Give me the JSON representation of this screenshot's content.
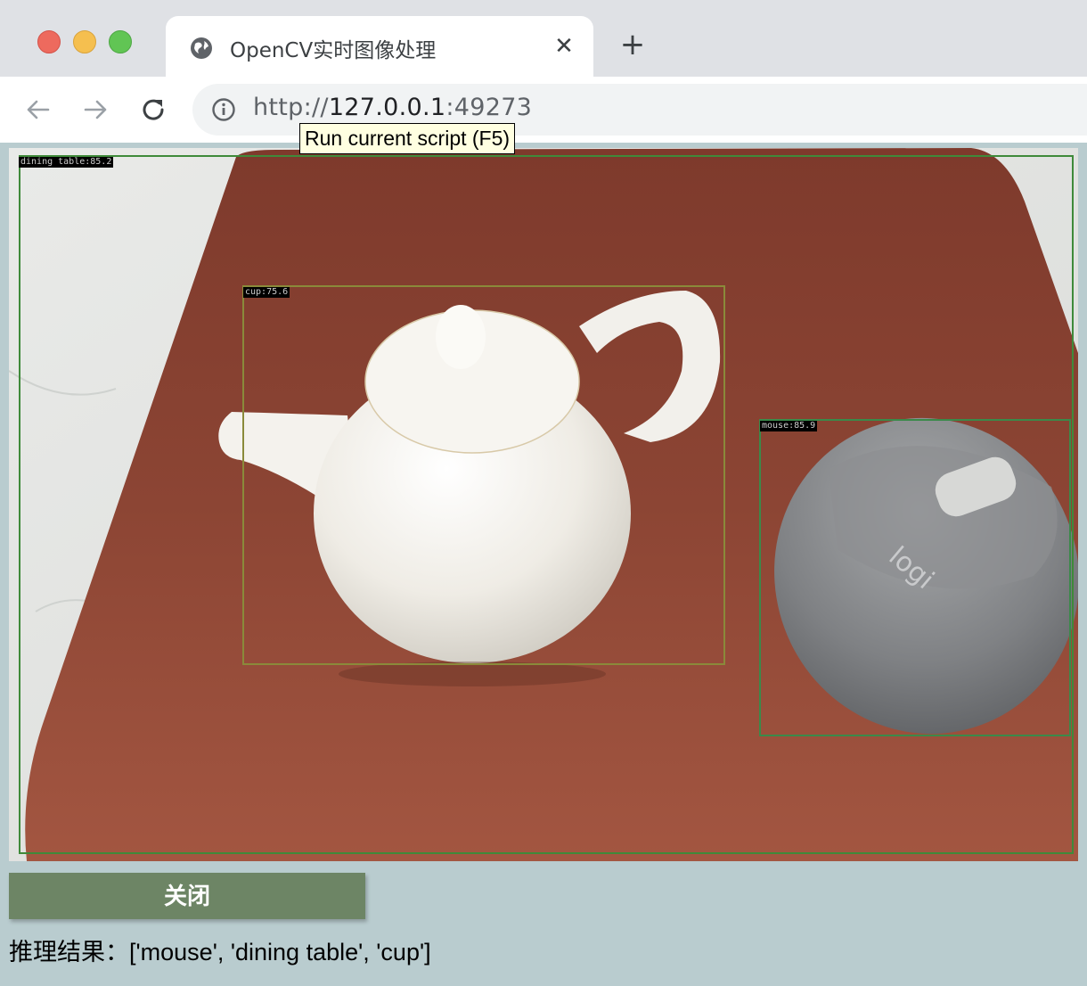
{
  "browser": {
    "tab_title": "OpenCV实时图像处理",
    "tab_close": "✕",
    "new_tab": "+",
    "url_scheme": "http://",
    "url_host": "127.0.0.1",
    "url_port": ":49273",
    "tooltip": "Run current script (F5)"
  },
  "detections": [
    {
      "label": "dining table:85.2",
      "color": "#3f8a3a"
    },
    {
      "label": "cup:75.6",
      "color": "#8a8a3a"
    },
    {
      "label": "mouse:85.9",
      "color": "#3a8a4a"
    }
  ],
  "footer": {
    "close_label": "关闭",
    "result_text": "推理结果：['mouse', 'dining table', 'cup']"
  },
  "colors": {
    "page_bg": "#b9cccf",
    "close_button": "#6d8565"
  }
}
